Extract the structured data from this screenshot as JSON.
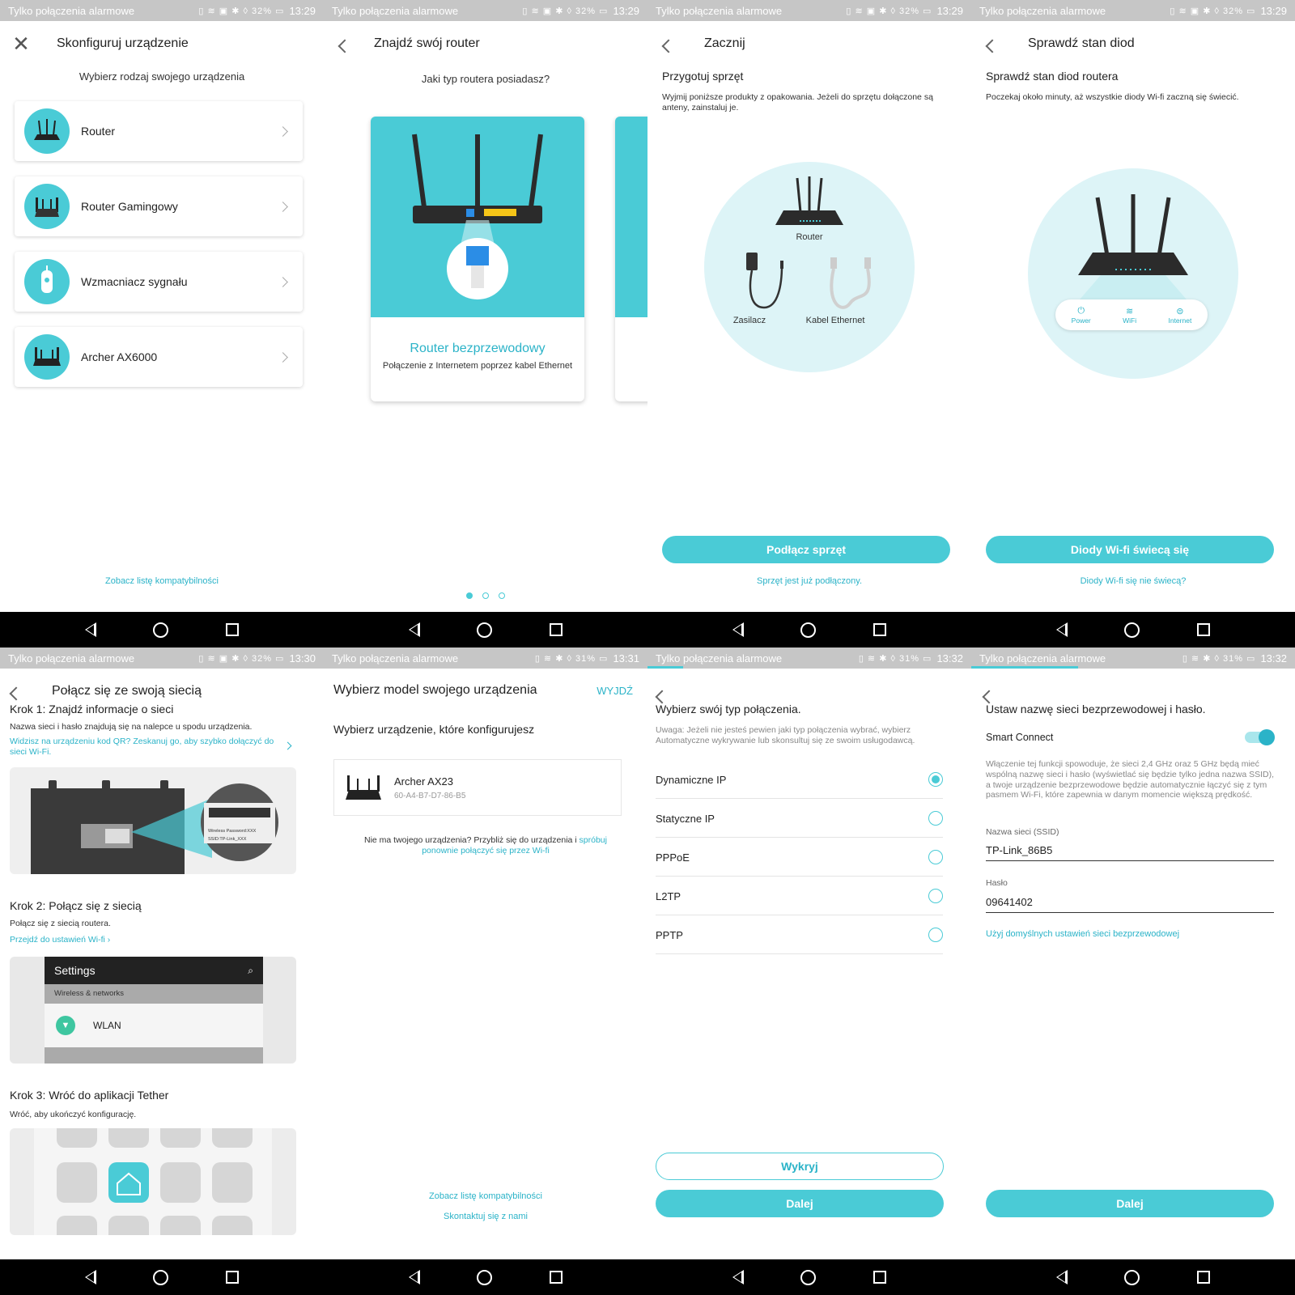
{
  "status": [
    {
      "carrier": "Tylko połączenia alarmowe",
      "battery": "32%",
      "time": "13:29"
    },
    {
      "carrier": "Tylko połączenia alarmowe",
      "battery": "32%",
      "time": "13:29"
    },
    {
      "carrier": "Tylko połączenia alarmowe",
      "battery": "32%",
      "time": "13:29"
    },
    {
      "carrier": "Tylko połączenia alarmowe",
      "battery": "32%",
      "time": "13:29"
    },
    {
      "carrier": "Tylko połączenia alarmowe",
      "battery": "32%",
      "time": "13:30"
    },
    {
      "carrier": "Tylko połączenia alarmowe",
      "battery": "31%",
      "time": "13:31"
    },
    {
      "carrier": "Tylko połączenia alarmowe",
      "battery": "31%",
      "time": "13:32"
    },
    {
      "carrier": "Tylko połączenia alarmowe",
      "battery": "31%",
      "time": "13:32"
    }
  ],
  "colors": {
    "accent": "#4acbd6",
    "link": "#2bb3c8",
    "statusbar": "#c6c6c6"
  },
  "s1": {
    "title": "Skonfiguruj urządzenie",
    "subtitle": "Wybierz rodzaj swojego urządzenia",
    "devices": [
      {
        "label": "Router"
      },
      {
        "label": "Router Gamingowy"
      },
      {
        "label": "Wzmacniacz sygnału"
      },
      {
        "label": "Archer AX6000"
      }
    ],
    "footer_link": "Zobacz listę kompatybilności"
  },
  "s2": {
    "title": "Znajdź swój router",
    "subtitle": "Jaki typ routera posiadasz?",
    "card_title": "Router bezprzewodowy",
    "card_desc": "Połączenie z Internetem poprzez kabel Ethernet",
    "pages": 3,
    "current_page": 1
  },
  "s3": {
    "title": "Zacznij",
    "heading": "Przygotuj sprzęt",
    "desc": "Wyjmij poniższe produkty z opakowania. Jeżeli do sprzętu dołączone są anteny, zainstaluj je.",
    "items": {
      "router": "Router",
      "adapter": "Zasilacz",
      "cable": "Kabel Ethernet"
    },
    "button": "Podłącz sprzęt",
    "link": "Sprzęt jest już podłączony."
  },
  "s4": {
    "title": "Sprawdź stan diod",
    "heading": "Sprawdź stan diod routera",
    "desc": "Poczekaj około minuty, aż wszystkie diody Wi-fi zaczną się świecić.",
    "leds": {
      "power": "Power",
      "wifi": "WiFi",
      "internet": "Internet"
    },
    "button": "Diody Wi-fi świecą się",
    "link": "Diody Wi-fi się nie świecą?"
  },
  "s5": {
    "title": "Połącz się ze swoją siecią",
    "step1_title": "Krok 1: Znajdź informacje o sieci",
    "step1_desc": "Nazwa sieci i hasło znajdują się na nalepce u spodu urządzenia.",
    "step1_link": "Widzisz na urządzeniu kod QR? Zeskanuj go, aby szybko dołączyć do sieci Wi-Fi.",
    "label_line1": "Wireless Password:XXX",
    "label_line2": "SSID:TP-Link_XXX",
    "step2_title": "Krok 2: Połącz się z siecią",
    "step2_desc": "Połącz się z siecią routera.",
    "step2_link": "Przejdź do ustawień Wi-fi",
    "settings_title": "Settings",
    "settings_section": "Wireless & networks",
    "settings_item": "WLAN",
    "step3_title": "Krok 3: Wróć do aplikacji Tether",
    "step3_desc": "Wróć, aby ukończyć konfigurację."
  },
  "s6": {
    "title": "Wybierz model swojego urządzenia",
    "exit": "WYJDŹ",
    "subtitle": "Wybierz urządzenie, które konfigurujesz",
    "device_name": "Archer AX23",
    "device_mac": "60-A4-B7-D7-86-B5",
    "note": "Nie ma twojego urządzenia? Przybliż się do urządzenia i ",
    "note_link": "spróbuj ponownie połączyć się przez Wi-fi",
    "footer_link1": "Zobacz listę kompatybilności",
    "footer_link2": "Skontaktuj się z nami"
  },
  "s7": {
    "heading": "Wybierz swój typ połączenia.",
    "note": "Uwaga: Jeżeli nie jesteś pewien jaki typ połączenia wybrać, wybierz Automatyczne wykrywanie lub skonsultuj się ze swoim usługodawcą.",
    "options": [
      {
        "label": "Dynamiczne IP",
        "selected": true
      },
      {
        "label": "Statyczne IP",
        "selected": false
      },
      {
        "label": "PPPoE",
        "selected": false
      },
      {
        "label": "L2TP",
        "selected": false
      },
      {
        "label": "PPTP",
        "selected": false
      }
    ],
    "detect_button": "Wykryj",
    "next_button": "Dalej"
  },
  "s8": {
    "heading": "Ustaw nazwę sieci bezprzewodowej i hasło.",
    "smart_connect": "Smart Connect",
    "smart_connect_on": true,
    "smart_desc": "Włączenie tej funkcji spowoduje, że sieci 2,4 GHz oraz 5 GHz będą mieć wspólną nazwę sieci i hasło (wyświetlać się będzie tylko jedna nazwa SSID), a twoje urządzenie bezprzewodowe będzie automatycznie łączyć się z tym pasmem Wi-Fi, które zapewnia w danym momencie większą prędkość.",
    "ssid_label": "Nazwa sieci (SSID)",
    "ssid_value": "TP-Link_86B5",
    "password_label": "Hasło",
    "password_value": "09641402",
    "default_link": "Użyj domyślnych ustawień sieci bezprzewodowej",
    "next_button": "Dalej"
  }
}
